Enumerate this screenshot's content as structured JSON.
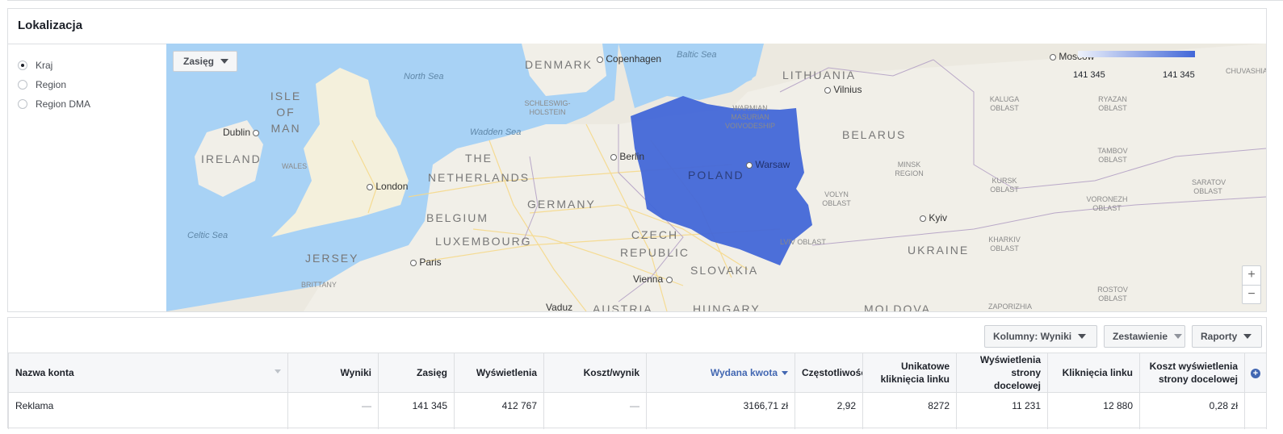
{
  "panel": {
    "title": "Lokalizacja"
  },
  "radios": [
    {
      "label": "Kraj",
      "selected": true
    },
    {
      "label": "Region",
      "selected": false
    },
    {
      "label": "Region DMA",
      "selected": false
    }
  ],
  "map": {
    "dropdown_label": "Zasięg",
    "legend_min": "141 345",
    "legend_max": "141 345",
    "highlight_color": "#4267d8",
    "zoom_in": "+",
    "zoom_out": "−",
    "countries": [
      "DENMARK",
      "LITHUANIA",
      "ISLE OF MAN",
      "IRELAND",
      "THE NETHERLANDS",
      "GERMANY",
      "BELGIUM",
      "LUXEMBOURG",
      "CZECH REPUBLIC",
      "SLOVAKIA",
      "BELARUS",
      "UKRAINE",
      "JERSEY",
      "POLAND",
      "AUSTRIA",
      "HUNGARY",
      "MOLDOVA"
    ],
    "cities": [
      "Copenhagen",
      "Moscow",
      "Vilnius",
      "Dublin",
      "London",
      "Berlin",
      "Warsaw",
      "Paris",
      "Vienna",
      "Kyiv",
      "Vaduz"
    ],
    "seas": [
      "Baltic Sea",
      "North Sea",
      "Wadden Sea",
      "Celtic Sea"
    ],
    "regions": [
      "SCHLESWIG-HOLSTEIN",
      "WARMIAN MASURIAN VOIVODESHIP",
      "KALUGA OBLAST",
      "RYAZAN OBLAST",
      "TAMBOV OBLAST",
      "MINSK REGION",
      "KURSK OBLAST",
      "VORONEZH OBLAST",
      "SARATOV OBLAST",
      "VOLYN OBLAST",
      "LVIV OBLAST",
      "KHARKIV OBLAST",
      "ROSTOV OBLAST",
      "ZAPORIZHIA",
      "WALES",
      "BRITTANY",
      "CHUVASHIA"
    ]
  },
  "toolbar": {
    "columns_label": "Kolumny: Wyniki",
    "breakdown_label": "Zestawienie",
    "reports_label": "Raporty"
  },
  "table": {
    "headers": [
      "Nazwa konta",
      "Wyniki",
      "Zasięg",
      "Wyświetlenia",
      "Koszt/wynik",
      "Wydana kwota",
      "Częstotliwość",
      "Unikatowe kliknięcia linku",
      "Wyświetlenia strony docelowej",
      "Kliknięcia linku",
      "Koszt wyświetlenia strony docelowej"
    ],
    "rows": [
      [
        "Reklama",
        "—",
        "141 345",
        "412 767",
        "—",
        "3166,71 zł",
        "2,92",
        "8272",
        "11 231",
        "12 880",
        "0,28 zł"
      ]
    ]
  }
}
